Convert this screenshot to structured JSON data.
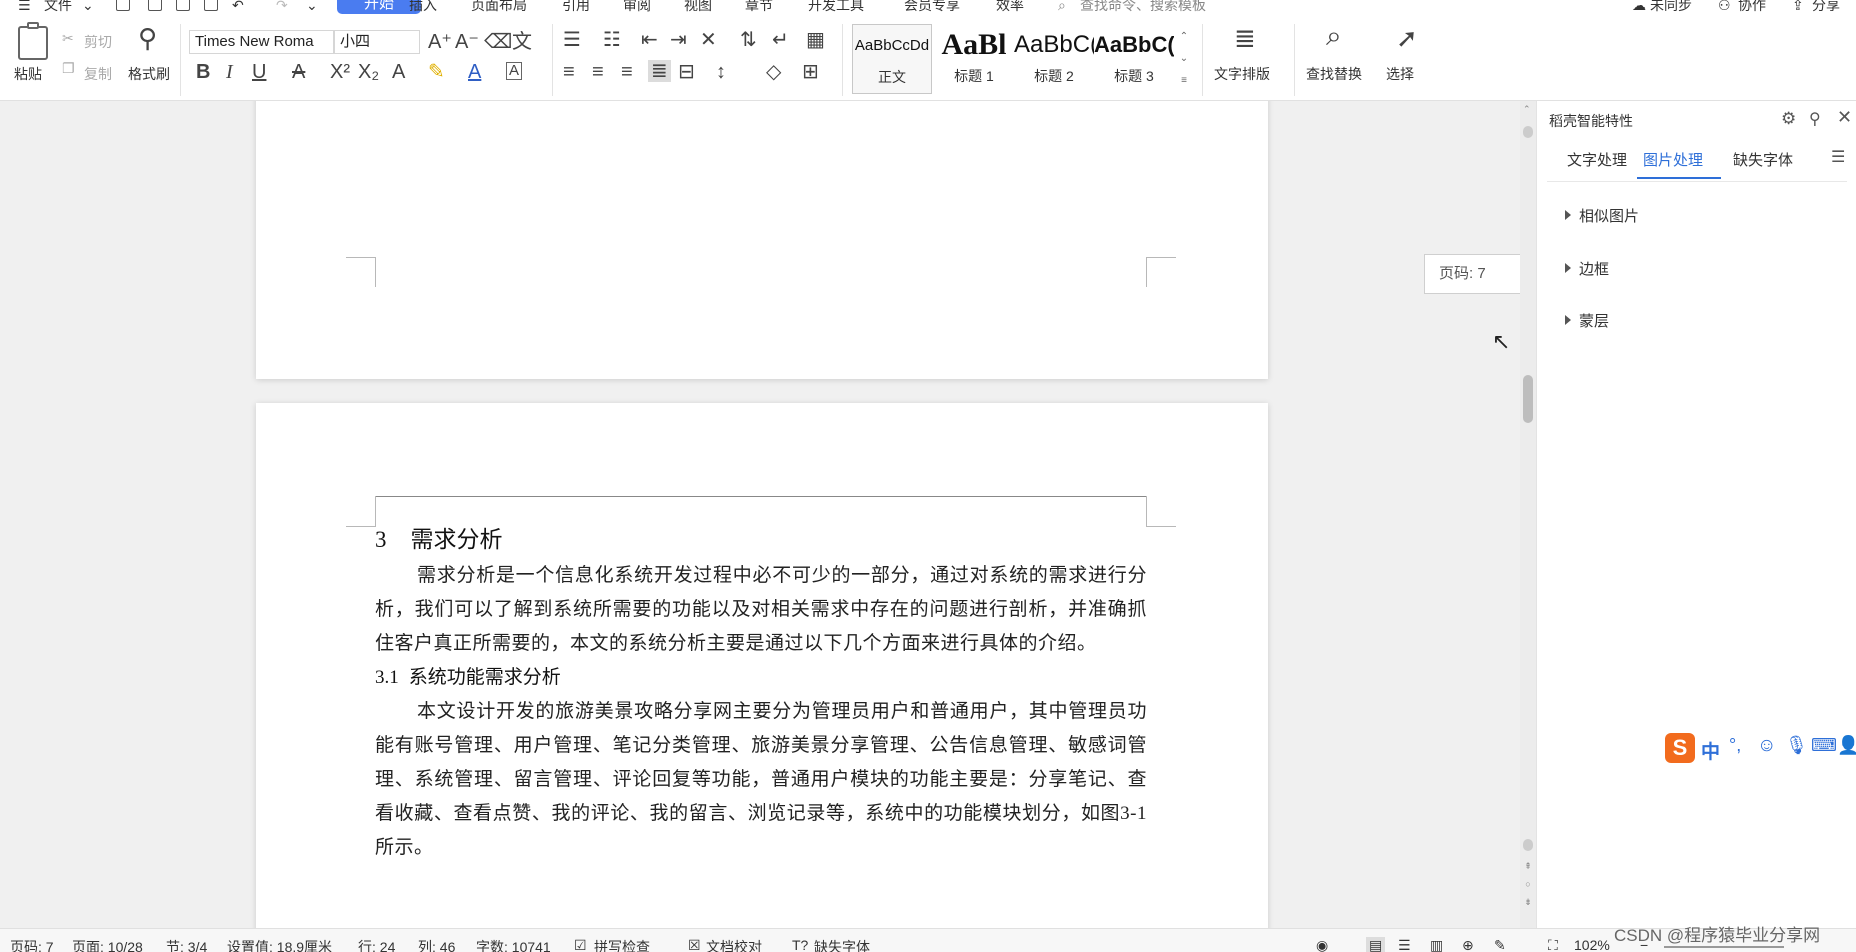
{
  "menubar": {
    "file_label": "文件",
    "tabs": [
      "开始",
      "插入",
      "页面布局",
      "引用",
      "审阅",
      "视图",
      "章节",
      "开发工具",
      "会员专享",
      "效率"
    ],
    "search_placeholder": "查找命令、搜索模板",
    "sync_label": "未同步",
    "collab_label": "协作",
    "share_label": "分享"
  },
  "ribbon": {
    "paste_label": "粘贴",
    "cut_label": "剪切",
    "copy_label": "复制",
    "format_painter_label": "格式刷",
    "font_name": "Times New Roma",
    "font_size": "小四",
    "styles": [
      {
        "sample": "AaBbCcDd",
        "name": "正文"
      },
      {
        "sample": "AaBl",
        "name": "标题 1"
      },
      {
        "sample": "AaBbC(",
        "name": "标题 2"
      },
      {
        "sample": "AaBbC(",
        "name": "标题 3"
      }
    ],
    "text_layout_label": "文字排版",
    "find_replace_label": "查找替换",
    "select_label": "选择"
  },
  "document": {
    "chapter_num": "3",
    "chapter_title": "需求分析",
    "para1": "需求分析是一个信息化系统开发过程中必不可少的一部分，通过对系统的需求进行分析，我们可以了解到系统所需要的功能以及对相关需求中存在的问题进行剖析，并准确抓住客户真正所需要的，本文的系统分析主要是通过以下几个方面来进行具体的介绍。",
    "section_num": "3.1",
    "section_title": "系统功能需求分析",
    "para2": "本文设计开发的旅游美景攻略分享网主要分为管理员用户和普通用户，其中管理员功能有账号管理、用户管理、笔记分类管理、旅游美景分享管理、公告信息管理、敏感词管理、系统管理、留言管理、评论回复等功能，普通用户模块的功能主要是：分享笔记、查看收藏、查看点赞、我的评论、我的留言、浏览记录等，系统中的功能模块划分，如图3-1所示。"
  },
  "page_tooltip": "页码: 7",
  "pane": {
    "title": "稻壳智能特性",
    "tabs": [
      "文字处理",
      "图片处理",
      "缺失字体"
    ],
    "active_tab": "图片处理",
    "items": [
      "相似图片",
      "边框",
      "蒙层"
    ]
  },
  "ime": {
    "label": "中"
  },
  "status": {
    "page_no": "页码: 7",
    "pages": "页面: 10/28",
    "section": "节: 3/4",
    "setting": "设置值: 18.9厘米",
    "row": "行: 24",
    "col": "列: 46",
    "word_count": "字数: 10741",
    "spell_check": "拼写检查",
    "doc_proof": "文档校对",
    "missing_font": "缺失字体",
    "zoom": "102%"
  },
  "watermark": "CSDN @程序猿毕业分享网",
  "colors": {
    "accent": "#4a7cf0",
    "ime_orange": "#f26b1d",
    "ime_blue": "#2e6fd8"
  }
}
